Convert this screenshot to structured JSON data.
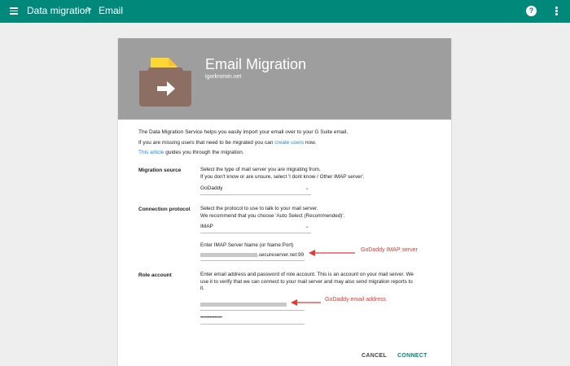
{
  "topbar": {
    "breadcrumb_1": "Data migration",
    "breadcrumb_sep": ">",
    "breadcrumb_2": "Email",
    "help": "?"
  },
  "card": {
    "title": "Email Migration",
    "subtitle": "igorkromin.net"
  },
  "intro": {
    "line1": "The Data Migration Service helps you easily import your email over to your G Suite email.",
    "line2_a": "If you are missing users that need to be migrated you can ",
    "line2_link": "create users",
    "line2_b": " now.",
    "line3_link": "This article",
    "line3_b": " guides you through the migration."
  },
  "migration_source": {
    "label": "Migration source",
    "desc1": "Select the type of mail server you are migrating from.",
    "desc2": "If you don't know or are unsure, select 'I dont know / Other IMAP server'.",
    "selected": "GoDaddy"
  },
  "connection_protocol": {
    "label": "Connection protocol",
    "desc1": "Select the protocol to use to talk to your mail server.",
    "desc2": "We recommend that you choose 'Auto Select (Recommended)'.",
    "selected": "IMAP",
    "server_label": "Enter IMAP Server Name (or Name:Port)",
    "server_value": ".secureserver.net:99"
  },
  "role_account": {
    "label": "Role account",
    "desc1": "Enter email address and password of role account. This is an account on your mail server. We",
    "desc2": "use it to verify that we can connect to your mail server and may also send migration reports to",
    "desc3": "it.",
    "password_value": "••••••••••••••"
  },
  "annotations": {
    "imap": "GoDaddy IMAP server",
    "email": "GoDaddy email address",
    "color": "#e53935"
  },
  "actions": {
    "cancel": "CANCEL",
    "connect": "CONNECT"
  },
  "colors": {
    "topbar": "#00897b",
    "header": "#9e9e9e",
    "link": "#1e88e5",
    "folder": "#8d6e63",
    "paper": "#fdd835"
  }
}
